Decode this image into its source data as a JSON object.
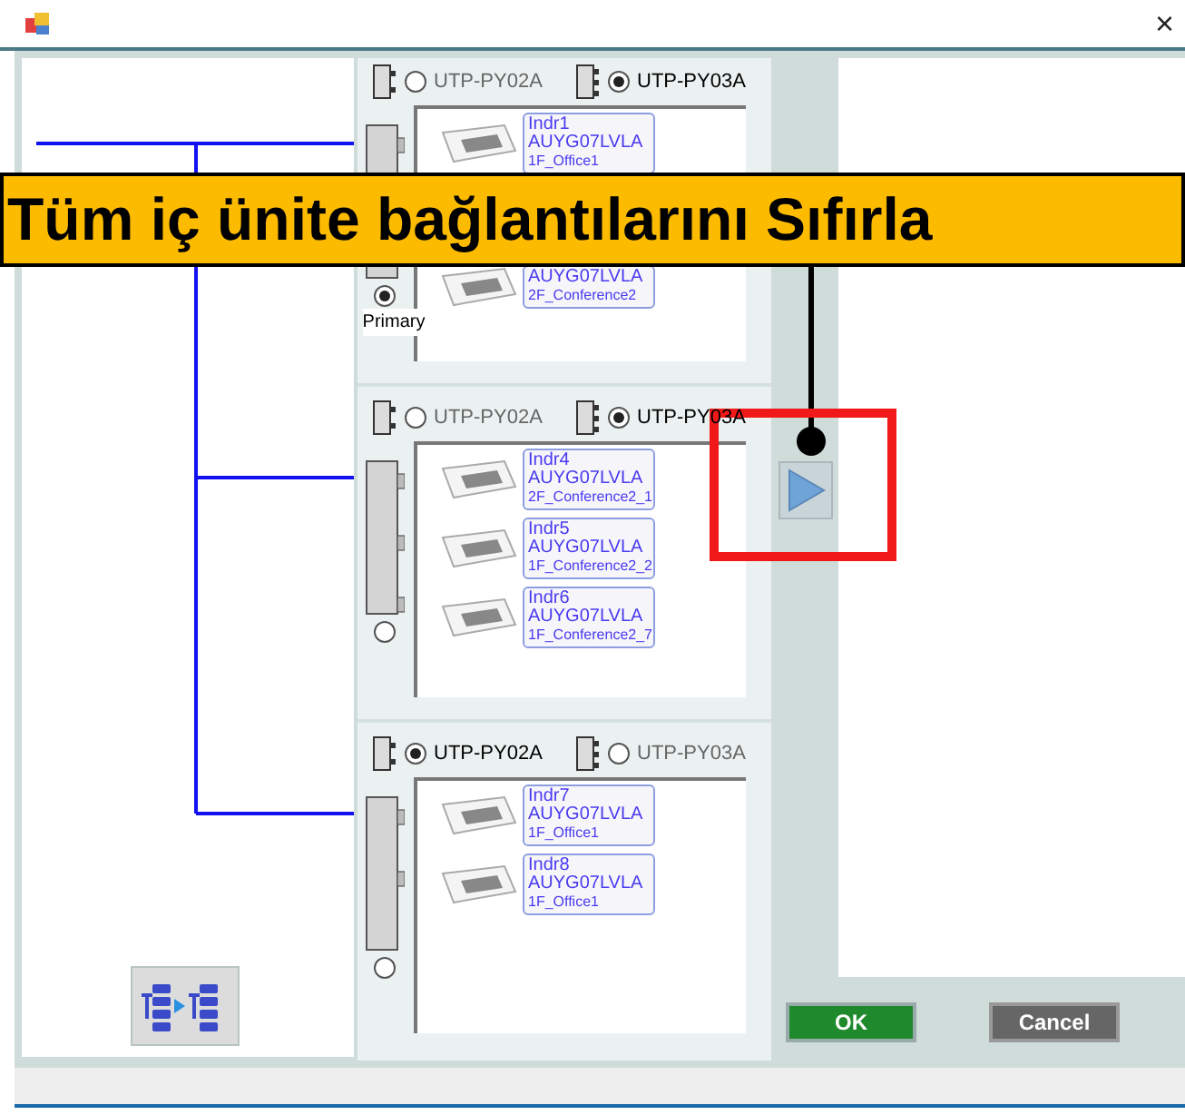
{
  "groups": [
    {
      "adapters": [
        {
          "label": "UTP-PY02A",
          "selected": false
        },
        {
          "label": "UTP-PY03A",
          "selected": true
        }
      ],
      "primary": {
        "selected": true,
        "label": "Primary"
      },
      "units": [
        {
          "name": "Indr1",
          "model": "AUYG07LVLA",
          "location": "1F_Office1"
        },
        {
          "model": "AUYG07LVLA",
          "location": "2F_Conference2"
        }
      ]
    },
    {
      "adapters": [
        {
          "label": "UTP-PY02A",
          "selected": false
        },
        {
          "label": "UTP-PY03A",
          "selected": true
        }
      ],
      "primary": {
        "selected": false
      },
      "units": [
        {
          "name": "Indr4",
          "model": "AUYG07LVLA",
          "location": "2F_Conference2_1"
        },
        {
          "name": "Indr5",
          "model": "AUYG07LVLA",
          "location": "1F_Conference2_2"
        },
        {
          "name": "Indr6",
          "model": "AUYG07LVLA",
          "location": "1F_Conference2_7"
        }
      ]
    },
    {
      "adapters": [
        {
          "label": "UTP-PY02A",
          "selected": true
        },
        {
          "label": "UTP-PY03A",
          "selected": false
        }
      ],
      "primary": {
        "selected": false
      },
      "units": [
        {
          "name": "Indr7",
          "model": "AUYG07LVLA",
          "location": "1F_Office1"
        },
        {
          "name": "Indr8",
          "model": "AUYG07LVLA",
          "location": "1F_Office1"
        }
      ]
    }
  ],
  "buttons": [
    {
      "label": "OK",
      "kind": "ok"
    },
    {
      "label": "Cancel",
      "kind": "cancel"
    }
  ],
  "window": {
    "close": "×"
  },
  "callout": {
    "text": "Tüm iç ünite bağlantılarını Sıfırla"
  }
}
